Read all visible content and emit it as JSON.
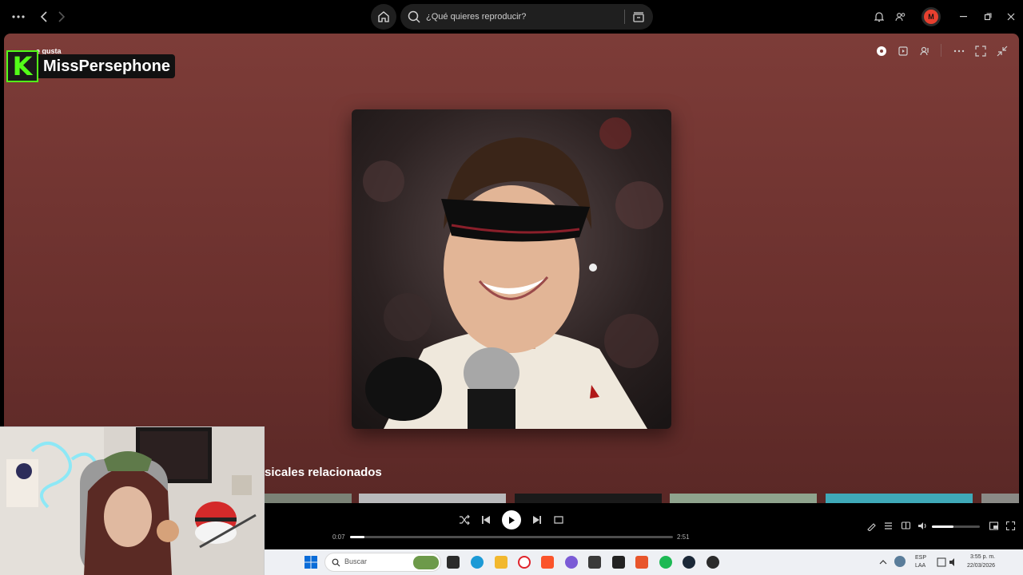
{
  "topbar": {
    "menu_icon": "more-dots-icon",
    "back_icon": "chevron-left-icon",
    "forward_icon": "chevron-right-icon",
    "home_icon": "home-icon",
    "search_placeholder": "¿Qué quieres reproducir?",
    "browse_icon": "browse-icon",
    "bell_icon": "bell-icon",
    "friends_icon": "friends-icon",
    "avatar_initial": "M"
  },
  "main": {
    "small_label": "e gusta",
    "stream_handle": "MissPersephone",
    "stream_logo_letter": "K",
    "related_title": "sicales relacionados"
  },
  "player": {
    "current_time": "0:07",
    "total_time": "2:51",
    "progress_fraction": 0.045,
    "volume_fraction": 0.45
  },
  "taskbar": {
    "search_label": "Buscar",
    "lang_top": "ESP",
    "lang_bottom": "LAA",
    "time": "3:55 p. m.",
    "date": "22/03/2026"
  },
  "colors": {
    "panel_top": "#7d3c38",
    "accent_green": "#53fc18",
    "avatar": "#e7402f",
    "spotify_green": "#1db954"
  }
}
